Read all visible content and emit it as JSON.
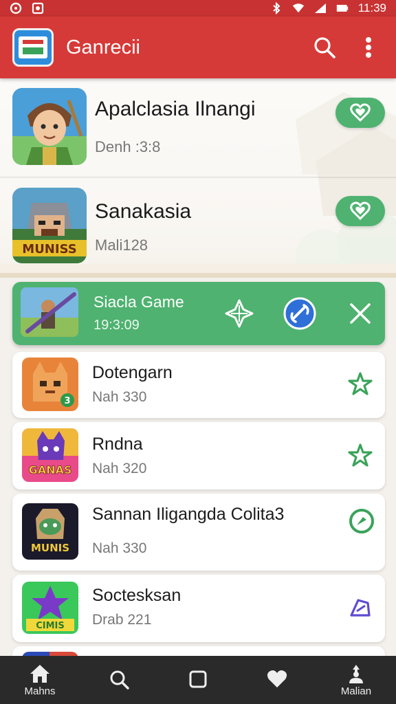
{
  "status_bar": {
    "time": "11:39"
  },
  "app_bar": {
    "title": "Ganrecii"
  },
  "featured": [
    {
      "title": "Apalclasia Ilnangi",
      "subtitle": "Denh :3:8"
    },
    {
      "title": "Sanakasia",
      "subtitle": "Mali128"
    }
  ],
  "selected": {
    "title": "Siacla Game",
    "subtitle": "19:3:09"
  },
  "list": [
    {
      "title": "Dotengarn",
      "subtitle": "Nah 330",
      "badge": "3"
    },
    {
      "title": "Rndna",
      "subtitle": "Nah 320",
      "thumb_text": "GANAS"
    },
    {
      "title": "Sannan Iligangda Colita3",
      "subtitle": "Nah 330",
      "thumb_text": "MUNIS"
    },
    {
      "title": "Soctesksan",
      "subtitle": "Drab 221",
      "thumb_text": "CIMIS"
    }
  ],
  "featured_thumb_text": "MUNISS",
  "bottom_nav": [
    {
      "label": "Mahns"
    },
    {
      "label": ""
    },
    {
      "label": ""
    },
    {
      "label": ""
    },
    {
      "label": "Malian"
    }
  ],
  "colors": {
    "status_bar": "#c83232",
    "app_bar": "#d63a38",
    "accent_green": "#4fb270",
    "bottom_nav": "#2a2a2a",
    "star_green": "#3aa35a",
    "purple_icon": "#5e4bd0"
  },
  "icons": {
    "status_left": [
      "sync-icon",
      "image-icon"
    ],
    "status_right": [
      "bluetooth-icon",
      "wifi-icon",
      "signal-icon",
      "battery-icon"
    ],
    "app_bar": [
      "search-icon",
      "more-vert-icon"
    ],
    "featured_action": "heart-icon",
    "selected_actions": [
      "move-icon",
      "link-icon",
      "close-icon"
    ],
    "list_actions": [
      "star-icon",
      "star-icon",
      "circle-icon",
      "edit-icon"
    ],
    "bottom_nav": [
      "home-icon",
      "search-icon",
      "square-icon",
      "heart-icon",
      "person-icon"
    ]
  }
}
